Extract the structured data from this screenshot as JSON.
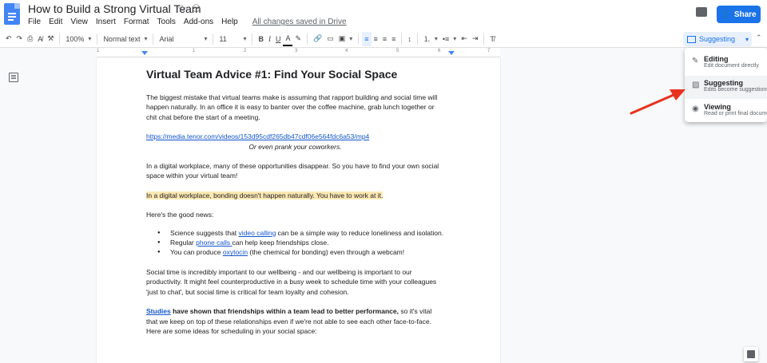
{
  "header": {
    "title": "How to Build a Strong Virtual Team",
    "menu": [
      "File",
      "Edit",
      "View",
      "Insert",
      "Format",
      "Tools",
      "Add-ons",
      "Help"
    ],
    "saved_status": "All changes saved in Drive",
    "share_label": "Share"
  },
  "toolbar": {
    "zoom": "100%",
    "style": "Normal text",
    "font": "Arial",
    "font_size": "11",
    "mode": "Suggesting"
  },
  "ruler": [
    "1",
    "1",
    "2",
    "3",
    "4",
    "5",
    "6",
    "7"
  ],
  "mode_menu": [
    {
      "title": "Editing",
      "subtitle": "Edit document directly"
    },
    {
      "title": "Suggesting",
      "subtitle": "Edits become suggestions"
    },
    {
      "title": "Viewing",
      "subtitle": "Read or print final document"
    }
  ],
  "doc": {
    "heading": "Virtual Team Advice #1: Find Your Social Space",
    "p1": "The biggest mistake that virtual teams make is assuming that rapport building and social time will happen naturally. In an office it is easy to banter over the coffee machine, grab lunch together or chit chat before the start of a meeting.",
    "link1": "https://media.tenor.com/videos/153d95cdf265db47cdf06e564fdc6a53/mp4",
    "caption": "Or even prank your coworkers.",
    "p2": "In a digital workplace, many of these opportunities disappear. So you have to find your own social space within your virtual team!",
    "highlight": "In a digital workplace, bonding doesn't happen naturally. You have to work at it.",
    "p3": "Here's the good news:",
    "b1_pre": "Science suggests that ",
    "b1_link": "video calling",
    "b1_post": " can be a simple way to reduce loneliness and isolation.",
    "b2_pre": "Regular ",
    "b2_link": "phone calls ",
    "b2_post": "can help keep friendships close.",
    "b3_pre": "You can produce ",
    "b3_link": "oxytocin",
    "b3_post": " (the chemical for bonding) even through a webcam!",
    "p4": "Social time is incredibly important to our wellbeing - and our wellbeing is important to our productivity. It might feel counterproductive in a busy week to schedule time with your colleagues 'just to chat', but social time is critical for team loyalty and cohesion.",
    "p5_link": "Studies",
    "p5_bold": " have shown that friendships within a team lead to better performance,",
    "p5_post": " so it's vital that we keep on top of these relationships even if we're not able to see each other face-to-face. Here are some ideas for scheduling in your social space:"
  }
}
